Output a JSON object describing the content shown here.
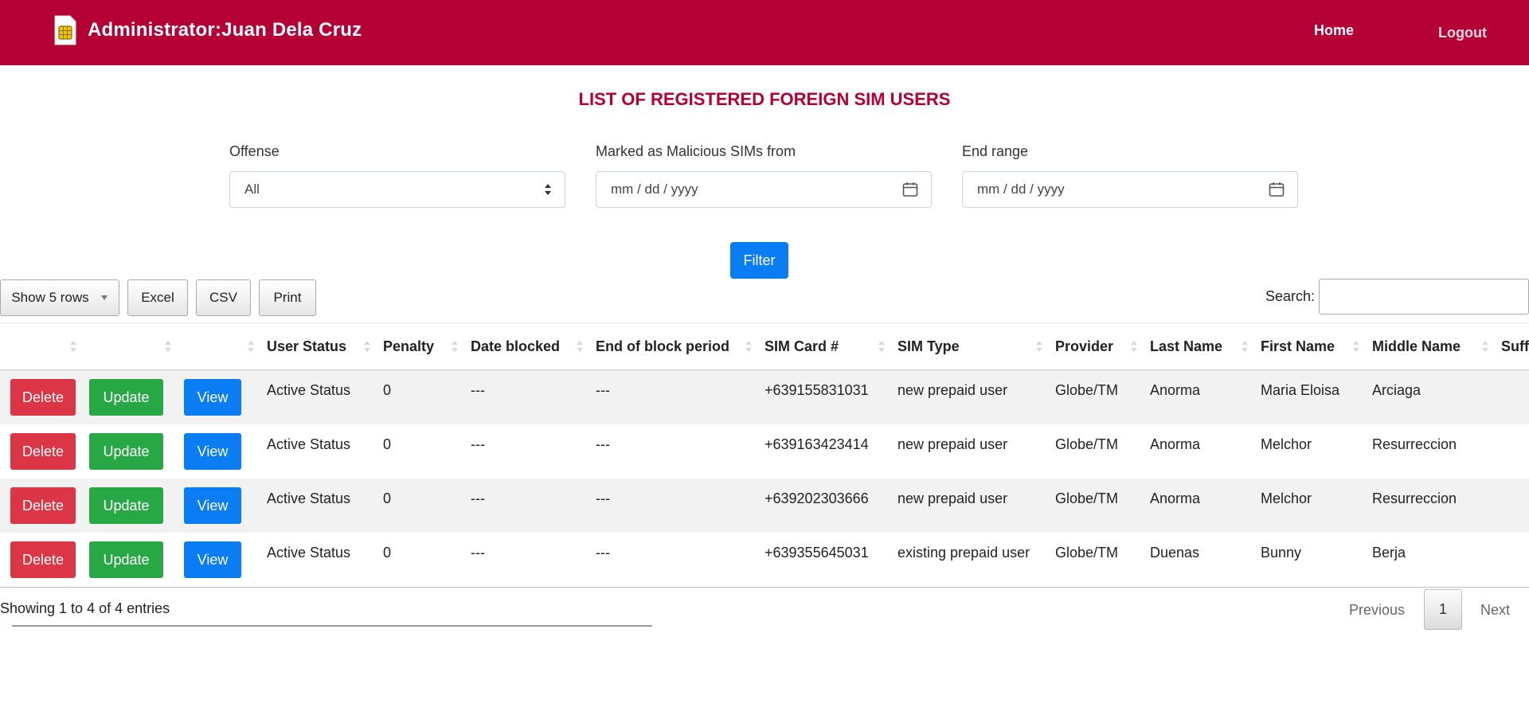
{
  "header": {
    "title": "Administrator:Juan Dela Cruz",
    "nav": {
      "home": "Home",
      "logout": "Logout"
    },
    "color": "#b50035"
  },
  "page_title": "LIST OF REGISTERED FOREIGN SIM USERS",
  "filters": {
    "offense": {
      "label": "Offense",
      "value": "All"
    },
    "from": {
      "label": "Marked as Malicious SIMs from",
      "placeholder": "mm / dd / yyyy"
    },
    "end": {
      "label": "End range",
      "placeholder": "mm / dd / yyyy"
    },
    "button": "Filter"
  },
  "toolbar": {
    "show_rows": "Show 5 rows",
    "excel": "Excel",
    "csv": "CSV",
    "print": "Print",
    "search_label": "Search:"
  },
  "table": {
    "columns": [
      "",
      "",
      "",
      "User Status",
      "Penalty",
      "Date blocked",
      "End of block period",
      "SIM Card #",
      "SIM Type",
      "Provider",
      "Last Name",
      "First Name",
      "Middle Name",
      "Suff"
    ],
    "action_labels": {
      "delete": "Delete",
      "update": "Update",
      "view": "View"
    },
    "rows": [
      {
        "status": "Active Status",
        "penalty": "0",
        "date_blocked": "---",
        "end_block": "---",
        "sim": "+639155831031",
        "type": "new prepaid user",
        "provider": "Globe/TM",
        "last": "Anorma",
        "first": "Maria Eloisa",
        "middle": "Arciaga"
      },
      {
        "status": "Active Status",
        "penalty": "0",
        "date_blocked": "---",
        "end_block": "---",
        "sim": "+639163423414",
        "type": "new prepaid user",
        "provider": "Globe/TM",
        "last": "Anorma",
        "first": "Melchor",
        "middle": "Resurreccion"
      },
      {
        "status": "Active Status",
        "penalty": "0",
        "date_blocked": "---",
        "end_block": "---",
        "sim": "+639202303666",
        "type": "new prepaid user",
        "provider": "Globe/TM",
        "last": "Anorma",
        "first": "Melchor",
        "middle": "Resurreccion"
      },
      {
        "status": "Active Status",
        "penalty": "0",
        "date_blocked": "---",
        "end_block": "---",
        "sim": "+639355645031",
        "type": "existing prepaid user",
        "provider": "Globe/TM",
        "last": "Duenas",
        "first": "Bunny",
        "middle": "Berja"
      }
    ]
  },
  "footer": {
    "info": "Showing 1 to 4 of 4 entries",
    "previous": "Previous",
    "current_page": "1",
    "next": "Next"
  }
}
